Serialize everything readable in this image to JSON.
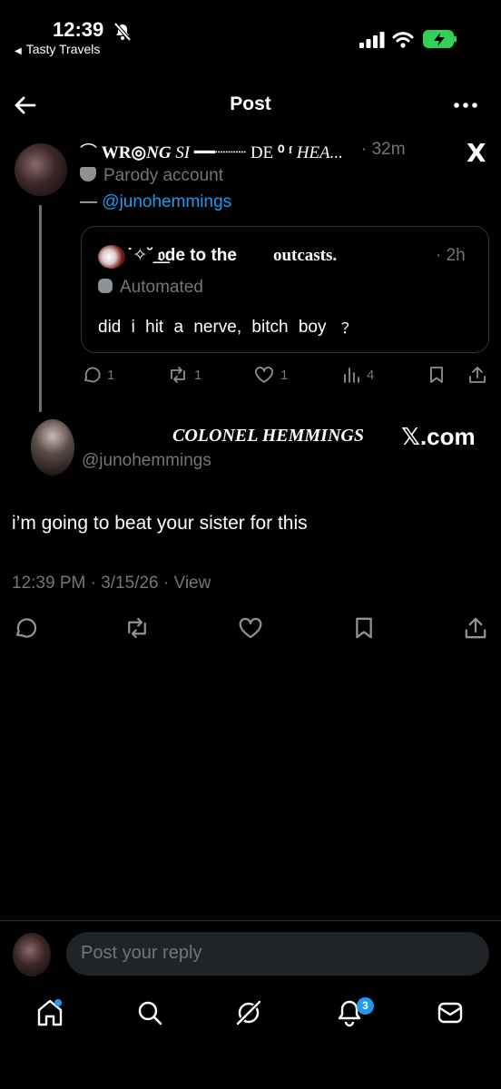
{
  "status_bar": {
    "time": "12:39",
    "back_app": "Tasty Travels",
    "battery_color": "#30d158"
  },
  "header": {
    "title": "Post"
  },
  "quoted_post": {
    "name_parts": [
      "⌒ ",
      "WR",
      "◎",
      "NG",
      " SI",
      " ━━┈┈┈ DE ",
      "⁰ ᶠ",
      " HEA..."
    ],
    "time": "· 32m",
    "x_glyph": "X",
    "parody_label": "Parody account",
    "handle_prefix": "— ",
    "handle_link": "@junohemmings",
    "embedded": {
      "name": "˙✧˘ ͟𝔬de to the",
      "name_serif": "outcasts.",
      "time": "· 2h",
      "automated_label": "Automated",
      "text": "did i hit a nerve,  bitch boy ﹖"
    },
    "actions": {
      "replies": "1",
      "reposts": "1",
      "likes": "1",
      "views": "4"
    }
  },
  "main_post": {
    "name": "COLONEL HEMMINGS",
    "xcom": "𝕏.com",
    "handle": "@junohemmings",
    "text": "i’m going to beat your sister for this",
    "meta": "12:39 PM · 3/15/26 · View"
  },
  "reply_bar": {
    "placeholder": "Post your reply"
  },
  "bottom_nav": {
    "notification_count": "3",
    "accent": "#1d9bf0"
  }
}
